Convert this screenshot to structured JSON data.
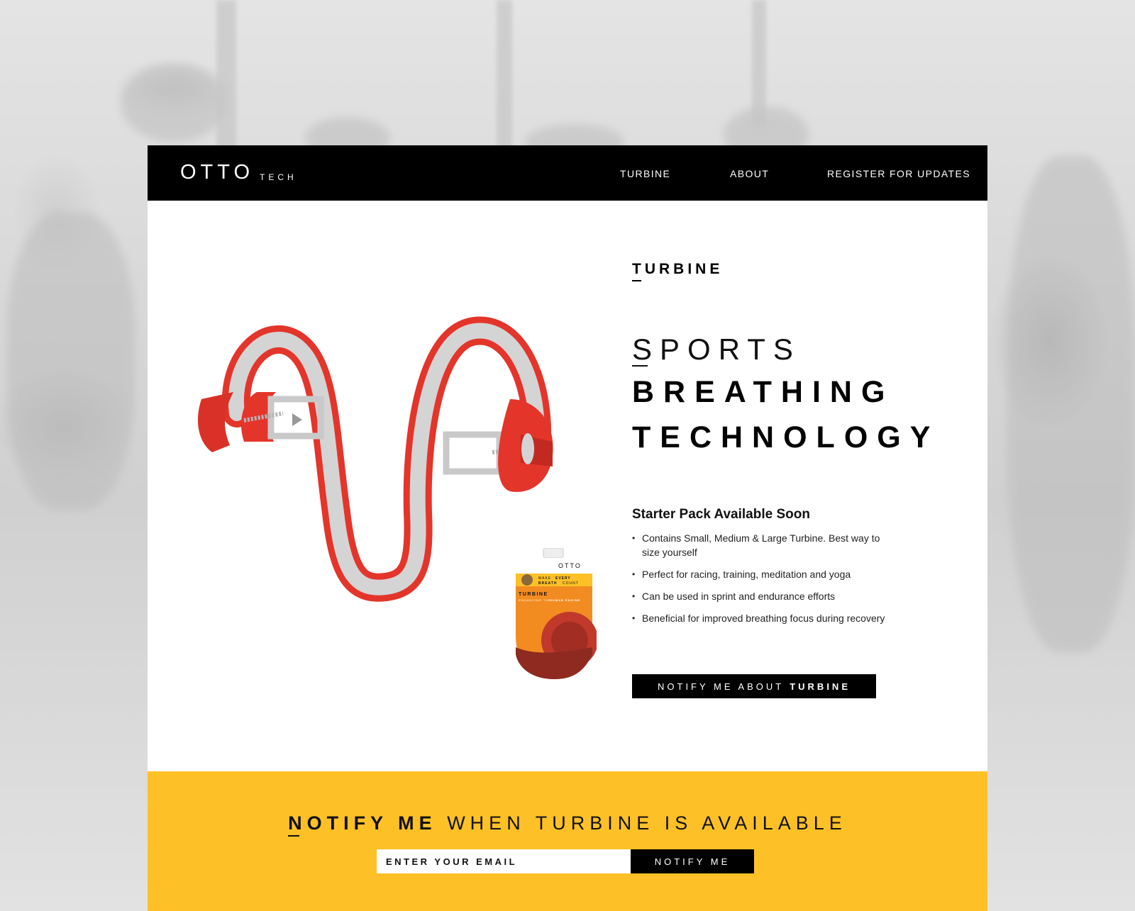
{
  "brand": {
    "name": "OTTO",
    "suffix": "TECH"
  },
  "nav": {
    "items": [
      {
        "label": "TURBINE"
      },
      {
        "label": "ABOUT"
      },
      {
        "label": "REGISTER FOR UPDATES"
      }
    ]
  },
  "hero": {
    "section_label": "TURBINE",
    "headline_line1": "SPORTS",
    "headline_line2": "BREATHING",
    "headline_line3": "TECHNOLOGY",
    "pack_title": "Starter Pack Available Soon",
    "features": [
      "Contains Small, Medium & Large Turbine. Best way to size yourself",
      "Perfect for racing, training, meditation and yoga",
      "Can be used in sprint and endurance efforts",
      "Beneficial for improved breathing focus during recovery"
    ],
    "cta_prefix": "NOTIFY ME ABOUT",
    "cta_bold": "TURBINE"
  },
  "package": {
    "brand": "OTTO",
    "tagline_1": "MAKE",
    "tagline_2": "EVERY",
    "tagline_3": "BREATH",
    "tagline_4": "COUNT",
    "product": "TURBINE",
    "subtitle_1": "ENHANCING THE",
    "subtitle_2": "HUMAN ENGINE"
  },
  "notify": {
    "heading_bold": "NOTIFY ME",
    "heading_rest": "WHEN TURBINE IS AVAILABLE",
    "email_placeholder": "ENTER YOUR EMAIL",
    "button_label": "NOTIFY ME"
  },
  "colors": {
    "accent_yellow": "#fdc127",
    "product_red": "#e4352b",
    "product_grey": "#d4d4d4",
    "nav_black": "#000000"
  }
}
